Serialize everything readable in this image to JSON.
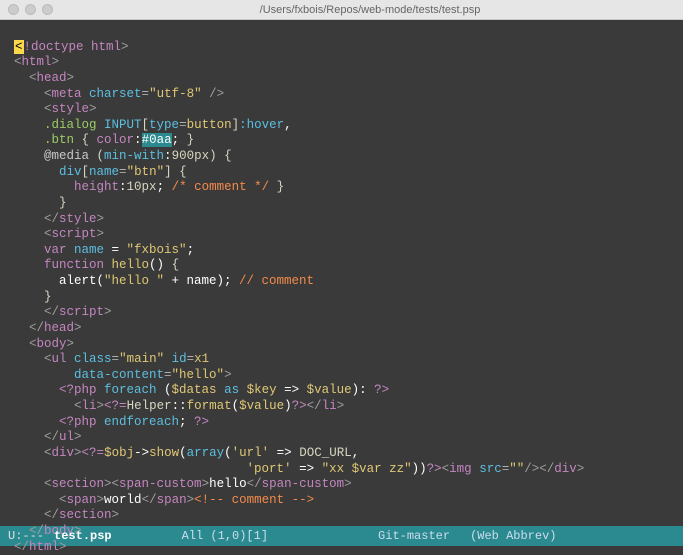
{
  "titlebar": {
    "path": "/Users/fxbois/Repos/web-mode/tests/test.psp"
  },
  "modeline": {
    "left": "U:---",
    "file": "test.psp",
    "pos": "All (1,0)[1]",
    "vcs": "Git-master",
    "mode": "(Web Abbrev)"
  },
  "code": {
    "l1_a": "<",
    "l1_b": "!doctype html",
    "l1_c": ">",
    "l2_a": "<",
    "l2_b": "html",
    "l2_c": ">",
    "l3_a": "  <",
    "l3_b": "head",
    "l3_c": ">",
    "l4_a": "    <",
    "l4_b": "meta ",
    "l4_c": "charset",
    "l4_d": "=",
    "l4_e": "\"utf-8\"",
    "l4_f": " />",
    "l5_a": "    <",
    "l5_b": "style",
    "l5_c": ">",
    "l6_a": "    .dialog ",
    "l6_b": "INPUT",
    "l6_c": "[",
    "l6_d": "type",
    "l6_e": "=",
    "l6_f": "button",
    "l6_g": "]",
    "l6_h": ":hover",
    "l6_i": ",",
    "l7_a": "    .btn ",
    "l7_b": "{ ",
    "l7_c": "color",
    "l7_d": ":",
    "l7_e": "#0aa",
    "l7_f": "; ",
    "l7_g": "}",
    "l8_a": "    @media ",
    "l8_b": "(",
    "l8_c": "min-with",
    "l8_d": ":",
    "l8_e": "900px",
    "l8_f": ") ",
    "l8_g": "{",
    "l9_a": "      div",
    "l9_b": "[",
    "l9_c": "name",
    "l9_d": "=",
    "l9_e": "\"btn\"",
    "l9_f": "] ",
    "l9_g": "{",
    "l10_a": "        height",
    "l10_b": ":",
    "l10_c": "10px",
    "l10_d": "; ",
    "l10_e": "/* comment */",
    "l10_f": " }",
    "l11_a": "      }",
    "l12_a": "    </",
    "l12_b": "style",
    "l12_c": ">",
    "l13_a": "    <",
    "l13_b": "script",
    "l13_c": ">",
    "l14_a": "    var ",
    "l14_b": "name",
    "l14_c": " = ",
    "l14_d": "\"fxbois\"",
    "l14_e": ";",
    "l15_a": "    function ",
    "l15_b": "hello",
    "l15_c": "() ",
    "l15_d": "{",
    "l16_a": "      alert(",
    "l16_b": "\"hello \"",
    "l16_c": " + name); ",
    "l16_d": "// comment",
    "l17_a": "    }",
    "l18_a": "    </",
    "l18_b": "script",
    "l18_c": ">",
    "l19_a": "  </",
    "l19_b": "head",
    "l19_c": ">",
    "l20_a": "  <",
    "l20_b": "body",
    "l20_c": ">",
    "l21_a": "    <",
    "l21_b": "ul ",
    "l21_c": "class",
    "l21_d": "=",
    "l21_e": "\"main\"",
    "l21_f": " id",
    "l21_g": "=",
    "l21_h": "x1",
    "l22_a": "        data-content",
    "l22_b": "=",
    "l22_c": "\"hello\"",
    "l22_d": ">",
    "l23_a": "      <?php ",
    "l23_b": "foreach ",
    "l23_c": "(",
    "l23_d": "$datas ",
    "l23_e": "as ",
    "l23_f": "$key ",
    "l23_g": "=> ",
    "l23_h": "$value",
    "l23_i": "): ",
    "l23_j": "?>",
    "l24_a": "        <",
    "l24_b": "li",
    "l24_c": ">",
    "l24_d": "<?=",
    "l24_e": "Helper",
    "l24_f": "::",
    "l24_g": "format",
    "l24_h": "(",
    "l24_i": "$value",
    "l24_j": ")",
    "l24_k": "?>",
    "l24_l": "</",
    "l24_m": "li",
    "l24_n": ">",
    "l25_a": "      <?php ",
    "l25_b": "endforeach",
    "l25_c": "; ",
    "l25_d": "?>",
    "l26_a": "    </",
    "l26_b": "ul",
    "l26_c": ">",
    "l27_a": "    <",
    "l27_b": "div",
    "l27_c": ">",
    "l27_d": "<?=",
    "l27_e": "$obj",
    "l27_f": "->",
    "l27_g": "show",
    "l27_h": "(",
    "l27_i": "array",
    "l27_j": "(",
    "l27_k": "'url'",
    "l27_l": " => ",
    "l27_m": "DOC_URL",
    "l27_n": ",",
    "l28_a": "                               ",
    "l28_b": "'port'",
    "l28_c": " => ",
    "l28_d": "\"xx ",
    "l28_e": "$var",
    "l28_f": " zz\"",
    "l28_g": "))",
    "l28_h": "?>",
    "l28_i": "<",
    "l28_j": "img ",
    "l28_k": "src",
    "l28_l": "=",
    "l28_m": "\"\"",
    "l28_n": "/></",
    "l28_o": "div",
    "l28_p": ">",
    "l29_a": "    <",
    "l29_b": "section",
    "l29_c": "><",
    "l29_d": "span-custom",
    "l29_e": ">",
    "l29_f": "hello",
    "l29_g": "</",
    "l29_h": "span-custom",
    "l29_i": ">",
    "l30_a": "      <",
    "l30_b": "span",
    "l30_c": ">",
    "l30_d": "world",
    "l30_e": "</",
    "l30_f": "span",
    "l30_g": ">",
    "l30_h": "<!-- comment -->",
    "l31_a": "    </",
    "l31_b": "section",
    "l31_c": ">",
    "l32_a": "  </",
    "l32_b": "body",
    "l32_c": ">",
    "l33_a": "</",
    "l33_b": "html",
    "l33_c": ">"
  }
}
